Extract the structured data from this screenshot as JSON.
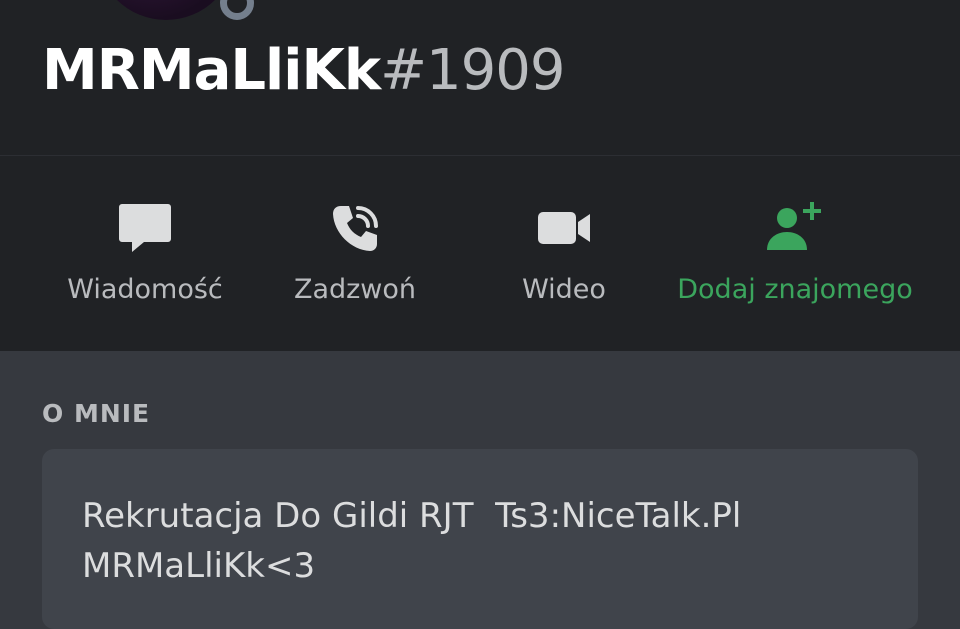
{
  "profile": {
    "username": "MRMaLliKk",
    "discriminator": "#1909"
  },
  "actions": [
    {
      "label": "Wiadomość",
      "icon": "message-icon"
    },
    {
      "label": "Zadzwoń",
      "icon": "phone-call-icon"
    },
    {
      "label": "Wideo",
      "icon": "video-icon"
    },
    {
      "label": "Dodaj znajomego",
      "icon": "add-friend-icon"
    }
  ],
  "about": {
    "title": "O MNIE",
    "line1": "Rekrutacja Do Gildi RJT  Ts3:NiceTalk.Pl",
    "line2": "MRMaLliKk<3"
  },
  "colors": {
    "header_bg": "#202225",
    "body_bg": "#36393f",
    "card_bg": "#40444b",
    "green": "#3ba55d",
    "muted": "#b9bbbe",
    "icon": "#dcddde"
  }
}
